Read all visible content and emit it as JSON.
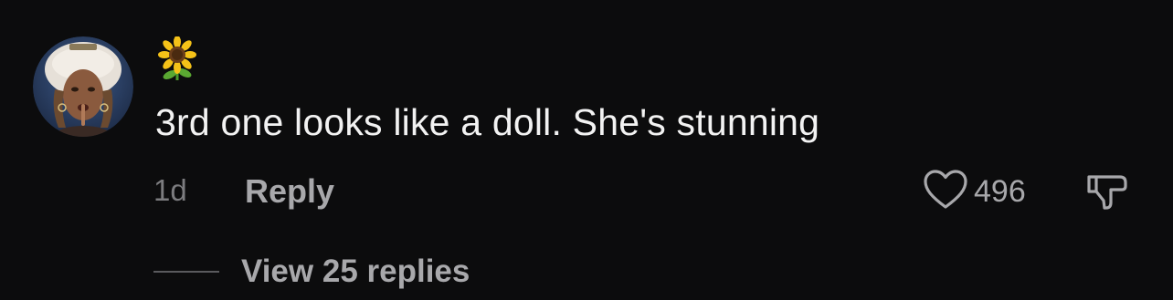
{
  "comment": {
    "author_badge_emoji": "sunflower",
    "text": "3rd one looks like a doll. She's stunning",
    "timestamp": "1d",
    "reply_label": "Reply",
    "like_count": "496",
    "view_replies_label": "View 25 replies"
  },
  "icons": {
    "like": "heart-outline-icon",
    "dislike": "thumbs-down-outline-icon"
  },
  "colors": {
    "background": "#0c0c0d",
    "primary_text": "#f2f2f2",
    "secondary_text": "#a8a8ab",
    "muted_text": "#7c7c7f"
  }
}
